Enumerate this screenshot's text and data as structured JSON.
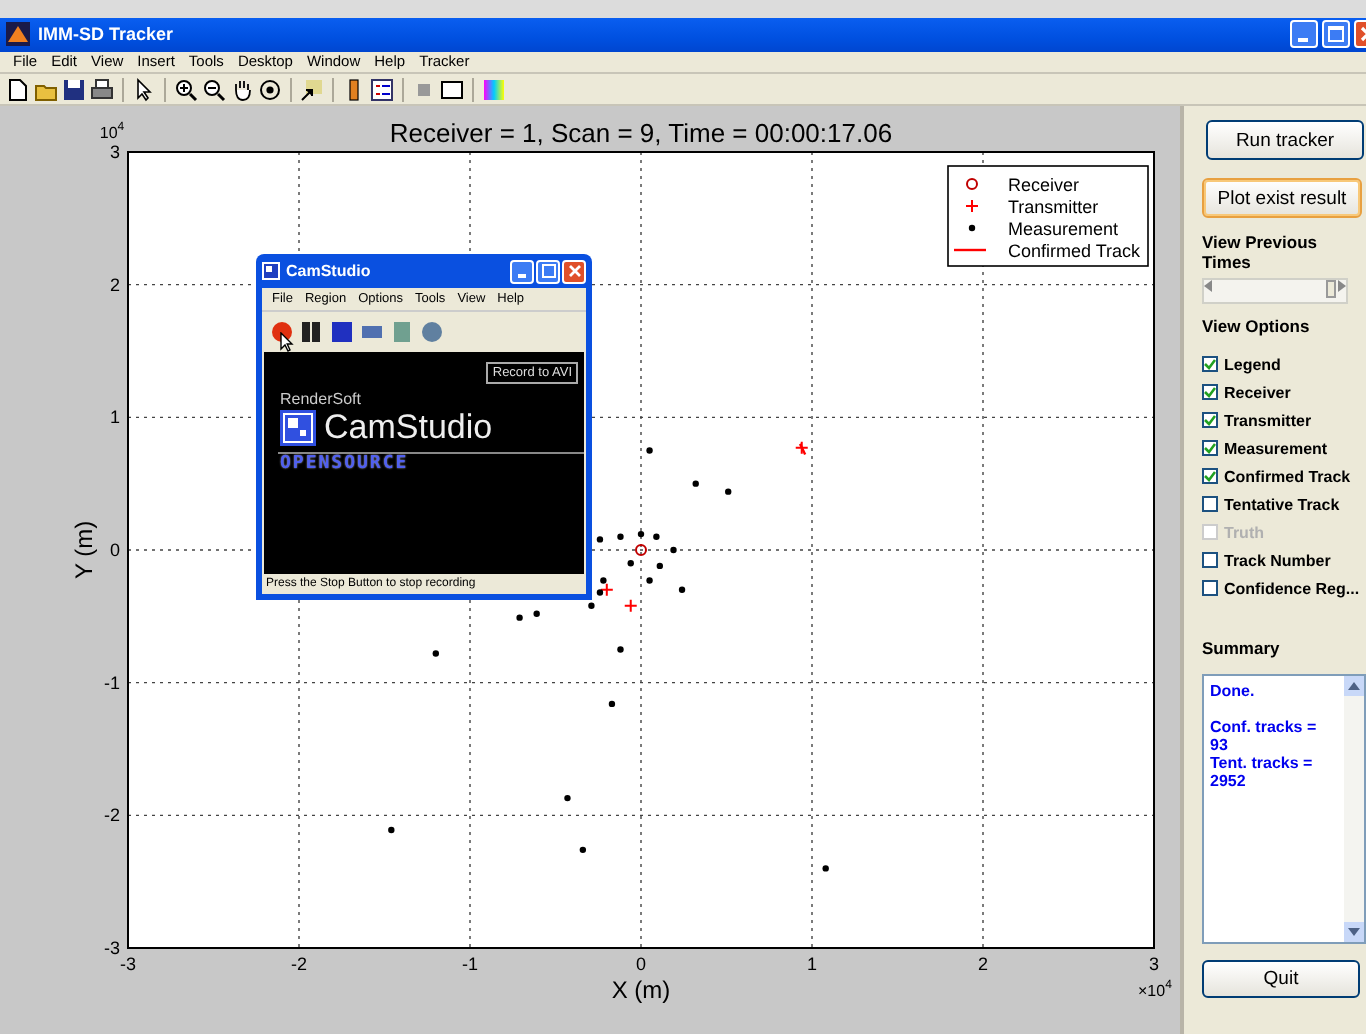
{
  "window": {
    "title": "IMM-SD Tracker"
  },
  "menu": [
    "File",
    "Edit",
    "View",
    "Insert",
    "Tools",
    "Desktop",
    "Window",
    "Help",
    "Tracker"
  ],
  "plot": {
    "y_multiplier": "10$^{4}$",
    "x_multiplier": "×10$^{4}$",
    "chart_data": {
      "type": "scatter",
      "title": "Receiver = 1, Scan = 9, Time = 00:00:17.06",
      "xlabel": "X (m)",
      "ylabel": "Y (m)",
      "xlim": [
        -3,
        3
      ],
      "ylim": [
        -3,
        3
      ],
      "xticks": [
        -3,
        -2,
        -1,
        0,
        1,
        2,
        3
      ],
      "yticks": [
        -3,
        -2,
        -1,
        0,
        1,
        2,
        3
      ],
      "grid": true,
      "legend": true,
      "series": [
        {
          "name": "Receiver",
          "color": "#c00000",
          "marker": "circle",
          "x": [
            0
          ],
          "values": [
            0
          ]
        },
        {
          "name": "Transmitter",
          "color": "#ff0000",
          "marker": "cross",
          "x": [
            0.94,
            -0.06,
            -0.2
          ],
          "values": [
            0.77,
            -0.42,
            -0.3
          ]
        },
        {
          "name": "Measurement",
          "color": "#000000",
          "x": [
            0.32,
            0.51,
            0.05,
            -1.2,
            -0.71,
            -0.61,
            -0.29,
            -0.12,
            -0.17,
            -0.43,
            -0.34,
            -1.46,
            1.08,
            -0.24,
            -0.12,
            0,
            0.09,
            0.19,
            0.11,
            -0.06,
            -0.22,
            0.24,
            0.05,
            -0.24
          ],
          "values": [
            0.5,
            0.44,
            0.75,
            -0.78,
            -0.51,
            -0.48,
            -0.42,
            -0.75,
            -1.16,
            -1.87,
            -2.26,
            -2.11,
            -2.4,
            0.08,
            0.1,
            0.12,
            0.1,
            0,
            -0.12,
            -0.1,
            -0.23,
            -0.3,
            -0.23,
            -0.32
          ]
        },
        {
          "name": "Confirmed Track",
          "color": "#ff0000",
          "type": "line",
          "x": [
            0.93,
            0.96
          ],
          "values": [
            0.8,
            0.72
          ]
        }
      ]
    }
  },
  "camstudio": {
    "title": "CamStudio",
    "menu": [
      "File",
      "Region",
      "Options",
      "Tools",
      "View",
      "Help"
    ],
    "record_button": "Record to AVI",
    "vendor": "RenderSoft",
    "product": "CamStudio",
    "tagline": "OPENSOURCE",
    "status": "Press the Stop Button to stop recording"
  },
  "sidebar": {
    "run_button": "Run tracker",
    "plot_button": "Plot exist result",
    "history_label": "View Previous Times",
    "history_slider": {
      "level": 0.95
    },
    "options_label": "View Options",
    "options": [
      {
        "label": "Legend",
        "checked": true,
        "disabled": false
      },
      {
        "label": "Receiver",
        "checked": true,
        "disabled": false
      },
      {
        "label": "Transmitter",
        "checked": true,
        "disabled": false
      },
      {
        "label": "Measurement",
        "checked": true,
        "disabled": false
      },
      {
        "label": "Confirmed Track",
        "checked": true,
        "disabled": false
      },
      {
        "label": "Tentative Track",
        "checked": false,
        "disabled": false
      },
      {
        "label": "Truth",
        "checked": false,
        "disabled": true
      },
      {
        "label": "Track Number",
        "checked": false,
        "disabled": false
      },
      {
        "label": "Confidence Reg...",
        "checked": false,
        "disabled": false
      }
    ],
    "summary_label": "Summary",
    "summary_lines": [
      "Done.",
      "Conf. tracks = 93",
      "Tent. tracks = 2952"
    ],
    "quit_button": "Quit"
  }
}
